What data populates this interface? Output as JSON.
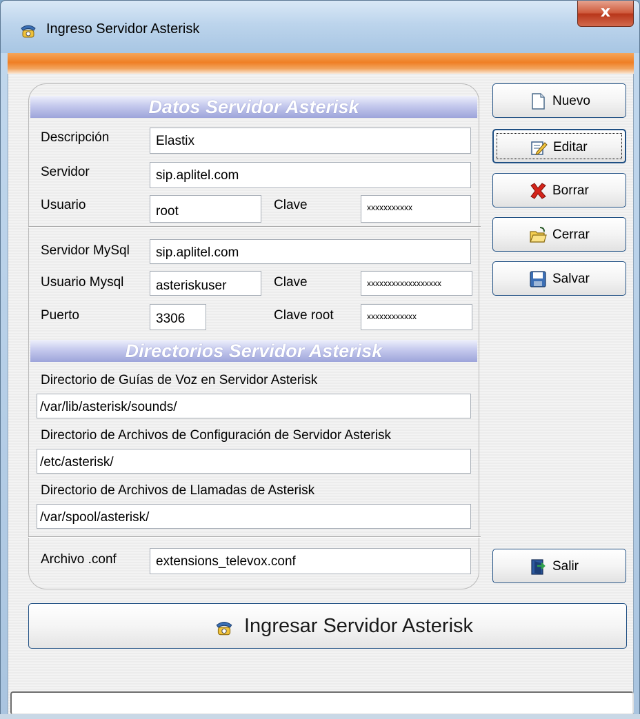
{
  "window": {
    "title": "Ingreso Servidor Asterisk",
    "close_label": "x"
  },
  "server_section": {
    "header": "Datos Servidor Asterisk",
    "descripcion_label": "Descripción",
    "descripcion_value": "Elastix",
    "servidor_label": "Servidor",
    "servidor_value": "sip.aplitel.com",
    "usuario_label": "Usuario",
    "usuario_value": "root",
    "clave_label": "Clave",
    "clave_value": "xxxxxxxxxxx",
    "servidor_mysql_label": "Servidor MySql",
    "servidor_mysql_value": "sip.aplitel.com",
    "usuario_mysql_label": "Usuario Mysql",
    "usuario_mysql_value": "asteriskuser",
    "clave_mysql_label": "Clave",
    "clave_mysql_value": "xxxxxxxxxxxxxxxxxx",
    "puerto_label": "Puerto",
    "puerto_value": "3306",
    "clave_root_label": "Clave root",
    "clave_root_value": "xxxxxxxxxxxx"
  },
  "dirs_section": {
    "header": "Directorios Servidor Asterisk",
    "voz_label": "Directorio de Guías de Voz en Servidor Asterisk",
    "voz_value": "/var/lib/asterisk/sounds/",
    "config_label": "Directorio de Archivos de Configuración de Servidor Asterisk",
    "config_value": "/etc/asterisk/",
    "llamadas_label": "Directorio de Archivos de Llamadas de Asterisk",
    "llamadas_value": "/var/spool/asterisk/",
    "conf_label": "Archivo .conf",
    "conf_value": "extensions_televox.conf"
  },
  "buttons": {
    "nuevo": "Nuevo",
    "editar": "Editar",
    "borrar": "Borrar",
    "cerrar": "Cerrar",
    "salvar": "Salvar",
    "salir": "Salir",
    "ingresar": "Ingresar Servidor Asterisk"
  },
  "status_text": ""
}
